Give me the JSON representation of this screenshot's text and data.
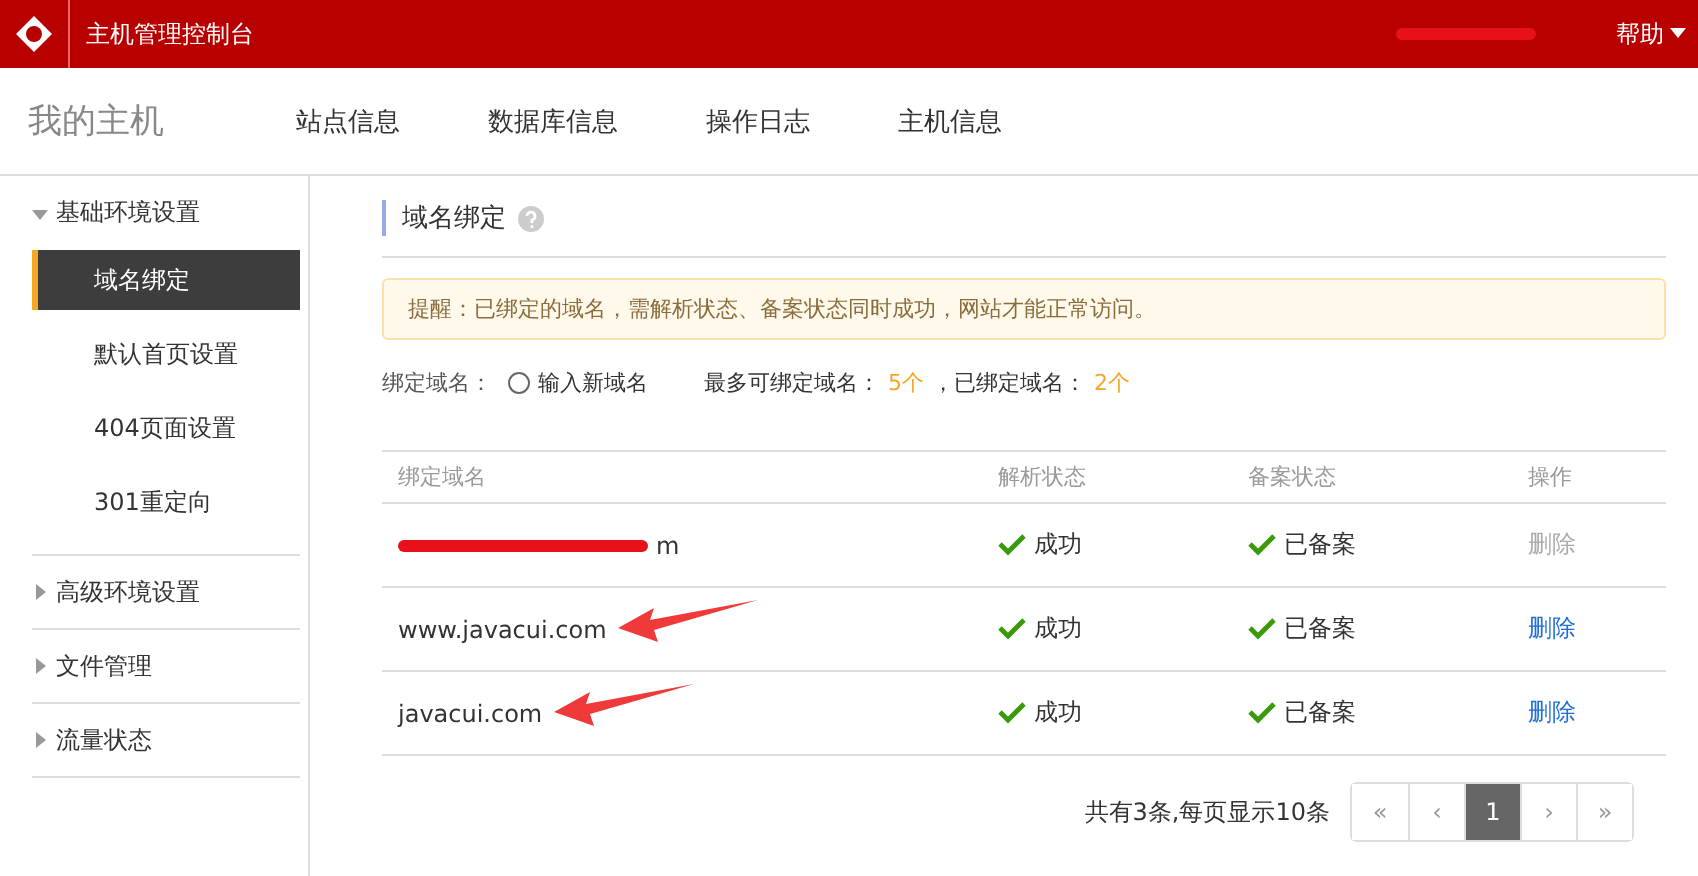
{
  "header": {
    "title": "主机管理控制台",
    "help": "帮助"
  },
  "nav": {
    "brand": "我的主机",
    "items": [
      {
        "label": "站点信息",
        "selected": false
      },
      {
        "label": "数据库信息",
        "selected": false
      },
      {
        "label": "操作日志",
        "selected": false
      },
      {
        "label": "主机信息",
        "selected": false
      }
    ]
  },
  "sidebar": {
    "groups": [
      {
        "label": "基础环境设置",
        "expanded": true,
        "children": [
          {
            "label": "域名绑定",
            "selected": true
          },
          {
            "label": "默认首页设置",
            "selected": false
          },
          {
            "label": "404页面设置",
            "selected": false
          },
          {
            "label": "301重定向",
            "selected": false
          }
        ]
      },
      {
        "label": "高级环境设置",
        "expanded": false
      },
      {
        "label": "文件管理",
        "expanded": false
      },
      {
        "label": "流量状态",
        "expanded": false
      }
    ]
  },
  "section": {
    "title": "域名绑定",
    "notice": "提醒：已绑定的域名，需解析状态、备案状态同时成功，网站才能正常访问。",
    "bind": {
      "label": "绑定域名：",
      "option": "输入新域名",
      "checked": false,
      "max_label": "最多可绑定域名：",
      "max_value": "5个",
      "bound_label": "，已绑定域名：",
      "bound_value": "2个"
    }
  },
  "table": {
    "columns": [
      "绑定域名",
      "解析状态",
      "备案状态",
      "操作"
    ],
    "rows": [
      {
        "domain": "m",
        "redacted": true,
        "arrow": false,
        "dns": "成功",
        "record": "已备案",
        "action": "删除",
        "disabled": true
      },
      {
        "domain": "www.javacui.com",
        "redacted": false,
        "arrow": true,
        "dns": "成功",
        "record": "已备案",
        "action": "删除",
        "disabled": false
      },
      {
        "domain": "javacui.com",
        "redacted": false,
        "arrow": true,
        "dns": "成功",
        "record": "已备案",
        "action": "删除",
        "disabled": false
      }
    ]
  },
  "pagination": {
    "summary": "共有3条,每页显示10条",
    "pages": [
      {
        "label": "«",
        "selected": false
      },
      {
        "label": "‹",
        "selected": false
      },
      {
        "label": "1",
        "selected": true
      },
      {
        "label": "›",
        "selected": false
      },
      {
        "label": "»",
        "selected": false
      }
    ]
  }
}
